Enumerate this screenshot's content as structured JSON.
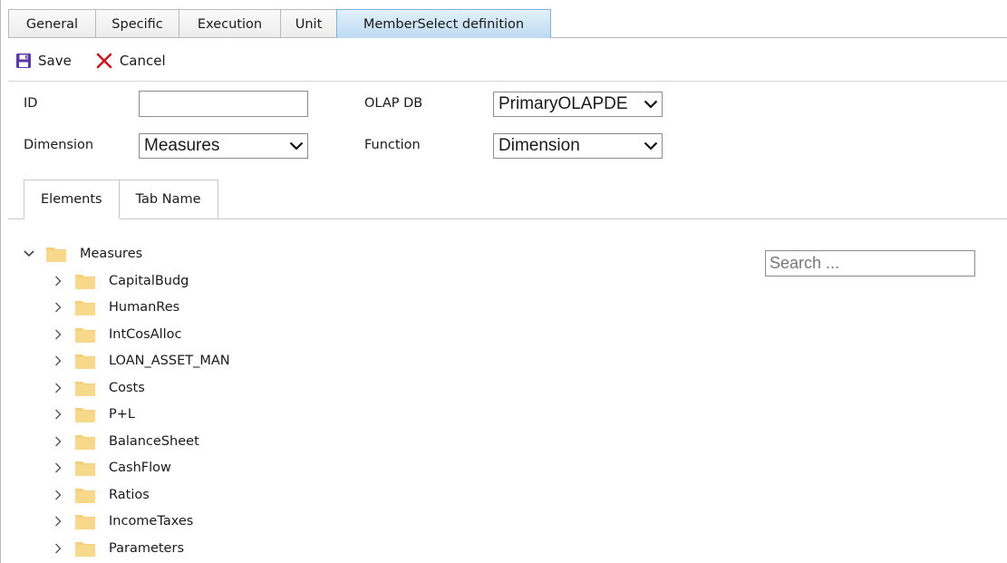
{
  "top_tabs": [
    {
      "label": "General"
    },
    {
      "label": "Specific"
    },
    {
      "label": "Execution"
    },
    {
      "label": "Unit"
    },
    {
      "label": "MemberSelect definition"
    }
  ],
  "active_top_tab": "MemberSelect definition",
  "toolbar": {
    "save_label": "Save",
    "cancel_label": "Cancel"
  },
  "form": {
    "id_label": "ID",
    "id_value": "",
    "olapdb_label": "OLAP DB",
    "olapdb_value": "PrimaryOLAPDE",
    "dimension_label": "Dimension",
    "dimension_value": "Measures",
    "function_label": "Function",
    "function_value": "Dimension"
  },
  "inner_tabs": [
    {
      "label": "Elements"
    },
    {
      "label": "Tab Name"
    }
  ],
  "active_inner_tab": "Elements",
  "search": {
    "placeholder": "Search ...",
    "value": ""
  },
  "tree": {
    "root": {
      "label": "Measures",
      "expanded": true,
      "icon": "folder-icon"
    },
    "children": [
      {
        "label": "CapitalBudg"
      },
      {
        "label": "HumanRes"
      },
      {
        "label": "IntCosAlloc"
      },
      {
        "label": "LOAN_ASSET_MAN"
      },
      {
        "label": "Costs"
      },
      {
        "label": "P+L"
      },
      {
        "label": "BalanceSheet"
      },
      {
        "label": "CashFlow"
      },
      {
        "label": "Ratios"
      },
      {
        "label": "IncomeTaxes"
      },
      {
        "label": "Parameters"
      }
    ]
  },
  "colors": {
    "active_tab_fill": "#bcdaf1",
    "folder": "#f5cf7a",
    "save_icon": "#5b3aa8",
    "cancel_icon": "#c8141e"
  }
}
